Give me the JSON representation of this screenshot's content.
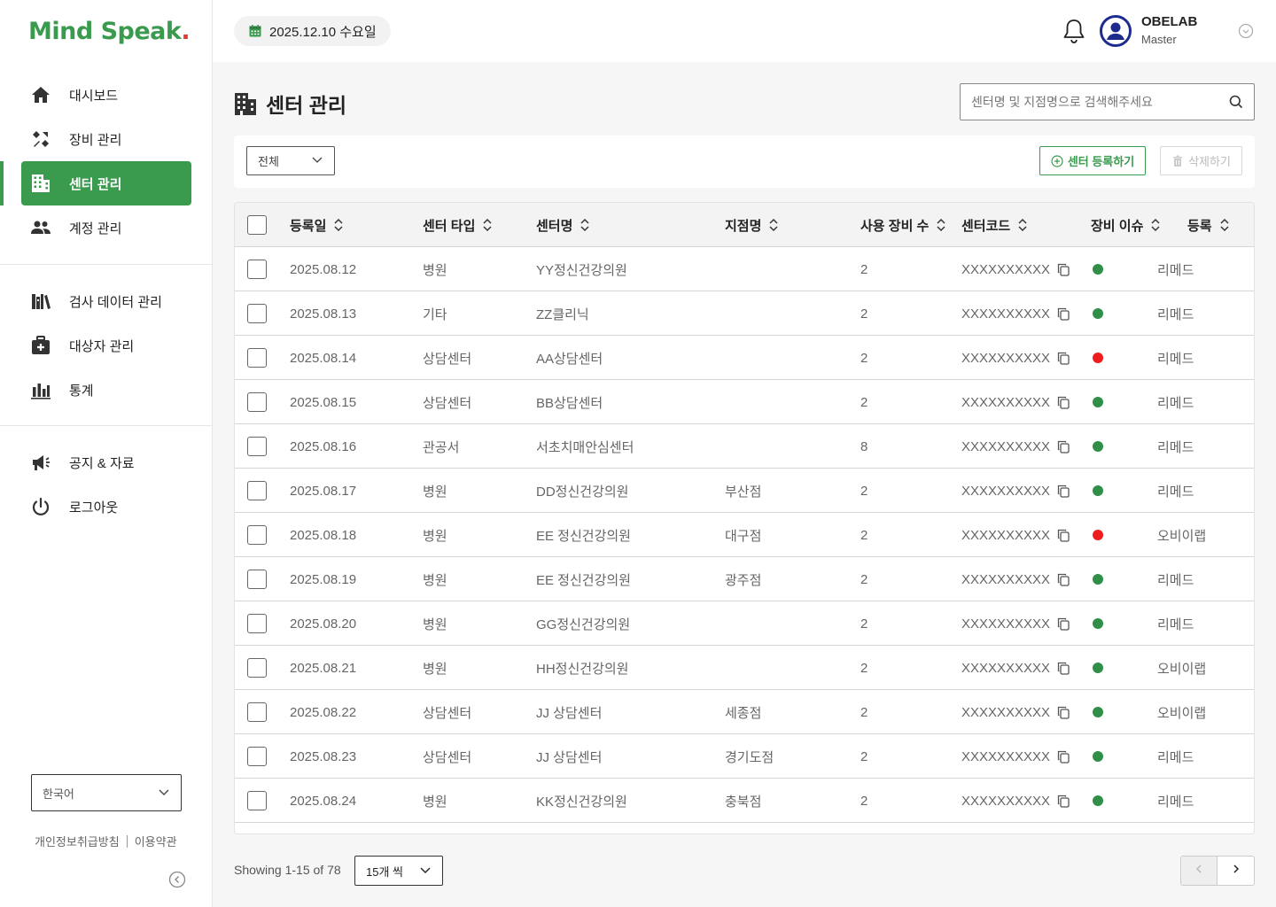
{
  "brand": {
    "logo_text": "Mind Speak",
    "logo_dot": ".",
    "color": "#3a9a4e"
  },
  "sidebar": {
    "menu_group1": [
      {
        "label": "대시보드",
        "icon": "home-icon"
      },
      {
        "label": "장비 관리",
        "icon": "tools-icon"
      },
      {
        "label": "센터 관리",
        "icon": "building-icon",
        "active": true
      },
      {
        "label": "계정 관리",
        "icon": "users-icon"
      }
    ],
    "menu_group2": [
      {
        "label": "검사 데이터 관리",
        "icon": "library-icon"
      },
      {
        "label": "대상자 관리",
        "icon": "medical-kit-icon"
      },
      {
        "label": "통계",
        "icon": "bar-chart-icon"
      }
    ],
    "menu_group3": [
      {
        "label": "공지 & 자료",
        "icon": "megaphone-icon"
      },
      {
        "label": "로그아웃",
        "icon": "power-icon"
      }
    ],
    "language": "한국어",
    "privacy_link": "개인정보취급방침",
    "terms_link": "이용약관"
  },
  "header": {
    "date": "2025.12.10 수요일",
    "user_name": "OBELAB",
    "user_role": "Master"
  },
  "page": {
    "title": "센터 관리",
    "search_placeholder": "센터명 및 지점명으로 검색해주세요",
    "filter_value": "전체",
    "register_button": "센터 등록하기",
    "delete_button": "삭제하기"
  },
  "table": {
    "columns": [
      "등록일",
      "센터 타입",
      "센터명",
      "지점명",
      "사용 장비 수",
      "센터코드",
      "장비 이슈",
      "등록"
    ],
    "rows": [
      {
        "date": "2025.08.12",
        "type": "병원",
        "name": "YY정신건강의원",
        "branch": "",
        "devices": "2",
        "code": "XXXXXXXXXX",
        "issue": "ok",
        "registrar": "리메드"
      },
      {
        "date": "2025.08.13",
        "type": "기타",
        "name": "ZZ클리닉",
        "branch": "",
        "devices": "2",
        "code": "XXXXXXXXXX",
        "issue": "ok",
        "registrar": "리메드"
      },
      {
        "date": "2025.08.14",
        "type": "상담센터",
        "name": "AA상담센터",
        "branch": "",
        "devices": "2",
        "code": "XXXXXXXXXX",
        "issue": "error",
        "registrar": "리메드"
      },
      {
        "date": "2025.08.15",
        "type": "상담센터",
        "name": "BB상담센터",
        "branch": "",
        "devices": "2",
        "code": "XXXXXXXXXX",
        "issue": "ok",
        "registrar": "리메드"
      },
      {
        "date": "2025.08.16",
        "type": "관공서",
        "name": "서초치매안심센터",
        "branch": "",
        "devices": "8",
        "code": "XXXXXXXXXX",
        "issue": "ok",
        "registrar": "리메드"
      },
      {
        "date": "2025.08.17",
        "type": "병원",
        "name": "DD정신건강의원",
        "branch": "부산점",
        "devices": "2",
        "code": "XXXXXXXXXX",
        "issue": "ok",
        "registrar": "리메드"
      },
      {
        "date": "2025.08.18",
        "type": "병원",
        "name": "EE 정신건강의원",
        "branch": "대구점",
        "devices": "2",
        "code": "XXXXXXXXXX",
        "issue": "error",
        "registrar": "오비이랩"
      },
      {
        "date": "2025.08.19",
        "type": "병원",
        "name": "EE 정신건강의원",
        "branch": "광주점",
        "devices": "2",
        "code": "XXXXXXXXXX",
        "issue": "ok",
        "registrar": "리메드"
      },
      {
        "date": "2025.08.20",
        "type": "병원",
        "name": "GG정신건강의원",
        "branch": "",
        "devices": "2",
        "code": "XXXXXXXXXX",
        "issue": "ok",
        "registrar": "리메드"
      },
      {
        "date": "2025.08.21",
        "type": "병원",
        "name": "HH정신건강의원",
        "branch": "",
        "devices": "2",
        "code": "XXXXXXXXXX",
        "issue": "ok",
        "registrar": "오비이랩"
      },
      {
        "date": "2025.08.22",
        "type": "상담센터",
        "name": "JJ 상담센터",
        "branch": "세종점",
        "devices": "2",
        "code": "XXXXXXXXXX",
        "issue": "ok",
        "registrar": "오비이랩"
      },
      {
        "date": "2025.08.23",
        "type": "상담센터",
        "name": "JJ 상담센터",
        "branch": "경기도점",
        "devices": "2",
        "code": "XXXXXXXXXX",
        "issue": "ok",
        "registrar": "리메드"
      },
      {
        "date": "2025.08.24",
        "type": "병원",
        "name": "KK정신건강의원",
        "branch": "충북점",
        "devices": "2",
        "code": "XXXXXXXXXX",
        "issue": "ok",
        "registrar": "리메드"
      }
    ]
  },
  "status_colors": {
    "ok": "#2f8f46",
    "error": "#ee1c1c"
  },
  "pagination": {
    "info": "Showing 1-15 of 78",
    "per_page": "15개 씩"
  }
}
